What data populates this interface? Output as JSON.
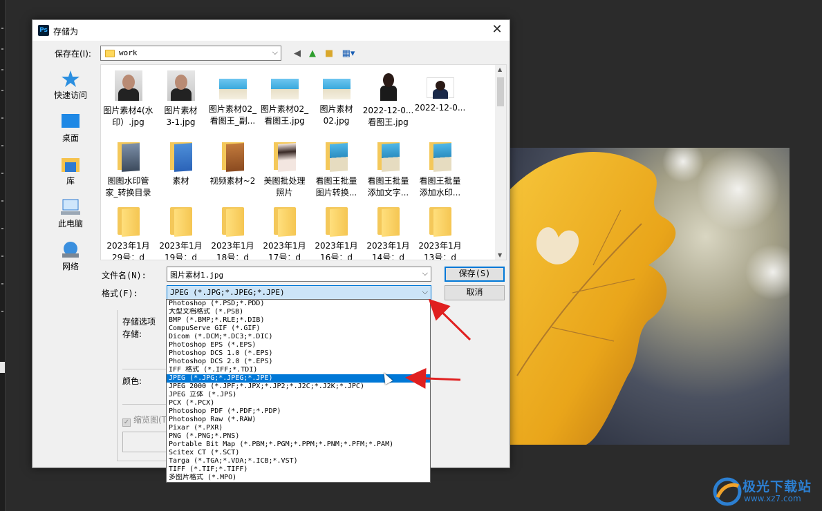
{
  "dialog": {
    "title": "存储为",
    "app_icon": "Ps",
    "close_glyph": "✕"
  },
  "location": {
    "label": "保存在(I):",
    "value": "work"
  },
  "places": [
    {
      "label": "快速访问",
      "icon": "star-icon"
    },
    {
      "label": "桌面",
      "icon": "desktop-icon"
    },
    {
      "label": "库",
      "icon": "library-icon"
    },
    {
      "label": "此电脑",
      "icon": "computer-icon"
    },
    {
      "label": "网络",
      "icon": "network-icon"
    }
  ],
  "files_row1": [
    {
      "name1": "图片素材4(水",
      "name2": "印）.jpg",
      "thumb": "portrait"
    },
    {
      "name1": "图片素材",
      "name2": "3-1.jpg",
      "thumb": "portrait"
    },
    {
      "name1": "图片素材02_",
      "name2": "看图王_副...",
      "thumb": "beach"
    },
    {
      "name1": "图片素材02_",
      "name2": "看图王.jpg",
      "thumb": "beach"
    },
    {
      "name1": "图片素材",
      "name2": "02.jpg",
      "thumb": "beach"
    },
    {
      "name1": "2022-12-0...",
      "name2": "看图王.jpg",
      "thumb": "girl"
    },
    {
      "name1": "2022-12-0...",
      "name2": "",
      "thumb": "girl2"
    }
  ],
  "files_row2": [
    {
      "name1": "图图水印管",
      "name2": "家_转换目录",
      "thumb": "fold-pic"
    },
    {
      "name1": "素材",
      "name2": "",
      "thumb": "fold-blue"
    },
    {
      "name1": "视频素材~2",
      "name2": "",
      "thumb": "fold-brown"
    },
    {
      "name1": "美图批处理",
      "name2": "照片",
      "thumb": "fold-person"
    },
    {
      "name1": "看图王批量",
      "name2": "图片转换...",
      "thumb": "fold-beach"
    },
    {
      "name1": "看图王批量",
      "name2": "添加文字...",
      "thumb": "fold-beach"
    },
    {
      "name1": "看图王批量",
      "name2": "添加水印...",
      "thumb": "fold-beach"
    }
  ],
  "files_row3": [
    {
      "name1": "2023年1月",
      "name2": "29号：d"
    },
    {
      "name1": "2023年1月",
      "name2": "19号：d"
    },
    {
      "name1": "2023年1月",
      "name2": "18号：d"
    },
    {
      "name1": "2023年1月",
      "name2": "17号：d"
    },
    {
      "name1": "2023年1月",
      "name2": "16号：d"
    },
    {
      "name1": "2023年1月",
      "name2": "14号：d"
    },
    {
      "name1": "2023年1月",
      "name2": "13号：d"
    }
  ],
  "filename": {
    "label": "文件名(N):",
    "value": "图片素材1.jpg"
  },
  "format": {
    "label": "格式(F):",
    "value": "JPEG (*.JPG;*.JPEG;*.JPE)"
  },
  "buttons": {
    "save": "保存(S)",
    "cancel": "取消"
  },
  "options": {
    "title": "存储选项",
    "store_label": "存储:",
    "color_label": "颜色:",
    "thumbnail_label": "缩览图(T"
  },
  "format_options": [
    "Photoshop (*.PSD;*.PDD)",
    "大型文档格式 (*.PSB)",
    "BMP (*.BMP;*.RLE;*.DIB)",
    "CompuServe GIF (*.GIF)",
    "Dicom (*.DCM;*.DC3;*.DIC)",
    "Photoshop EPS (*.EPS)",
    "Photoshop DCS 1.0 (*.EPS)",
    "Photoshop DCS 2.0 (*.EPS)",
    "IFF 格式 (*.IFF;*.TDI)",
    "JPEG (*.JPG;*.JPEG;*.JPE)",
    "JPEG 2000 (*.JPF;*.JPX;*.JP2;*.J2C;*.J2K;*.JPC)",
    "JPEG 立体 (*.JPS)",
    "PCX (*.PCX)",
    "Photoshop PDF (*.PDF;*.PDP)",
    "Photoshop Raw (*.RAW)",
    "Pixar (*.PXR)",
    "PNG (*.PNG;*.PNS)",
    "Portable Bit Map (*.PBM;*.PGM;*.PPM;*.PNM;*.PFM;*.PAM)",
    "Scitex CT (*.SCT)",
    "Targa (*.TGA;*.VDA;*.ICB;*.VST)",
    "TIFF (*.TIF;*.TIFF)",
    "多图片格式 (*.MPO)"
  ],
  "selected_format_index": 9,
  "watermark": {
    "name": "极光下载站",
    "url": "www.xz7.com"
  },
  "colors": {
    "accent": "#0078d7",
    "annotation_arrow": "#e02020"
  }
}
